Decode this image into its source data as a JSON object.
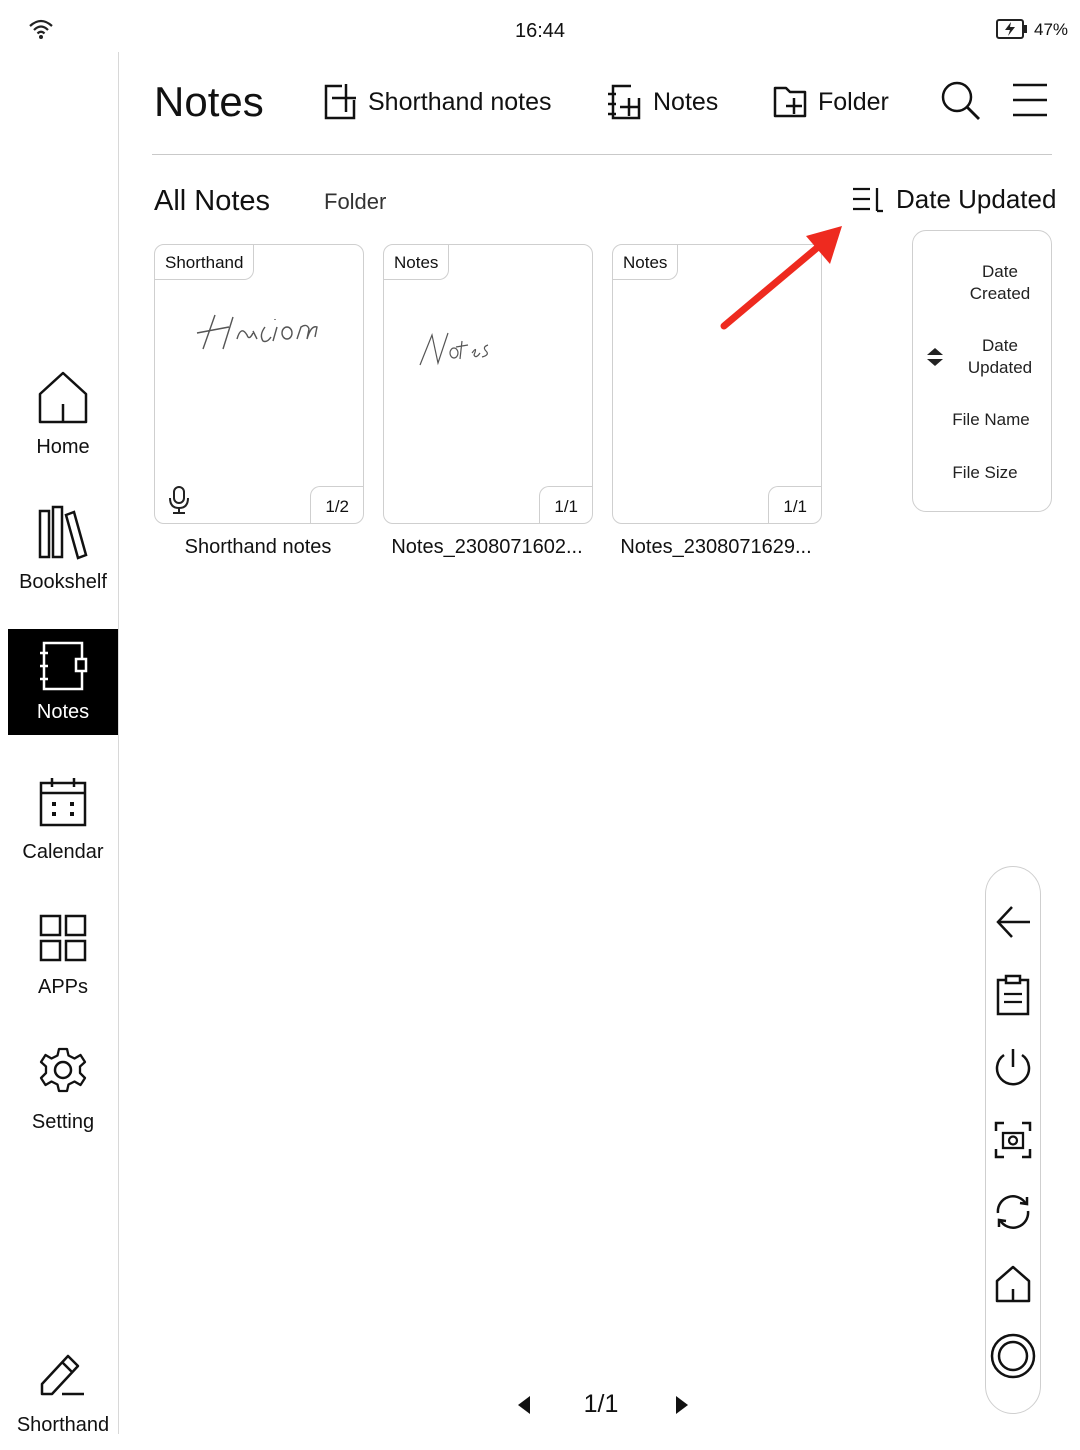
{
  "status_bar": {
    "time": "16:44",
    "battery": "47%"
  },
  "sidebar": {
    "items": [
      {
        "label": "Home",
        "icon": "home-icon"
      },
      {
        "label": "Bookshelf",
        "icon": "bookshelf-icon"
      },
      {
        "label": "Notes",
        "icon": "notebook-icon",
        "active": true
      },
      {
        "label": "Calendar",
        "icon": "calendar-icon"
      },
      {
        "label": "APPs",
        "icon": "apps-grid-icon"
      },
      {
        "label": "Setting",
        "icon": "gear-icon"
      },
      {
        "label": "Shorthand",
        "icon": "pen-icon"
      }
    ]
  },
  "header": {
    "title": "Notes",
    "actions": [
      {
        "label": "Shorthand notes",
        "icon": "new-shorthand-icon"
      },
      {
        "label": "Notes",
        "icon": "new-notebook-icon"
      },
      {
        "label": "Folder",
        "icon": "new-folder-icon"
      }
    ],
    "icons": [
      "search-icon",
      "menu-icon"
    ]
  },
  "tabs": {
    "all": "All Notes",
    "folder": "Folder"
  },
  "sort": {
    "label": "Date Updated",
    "options": [
      "Date Created",
      "Date Updated",
      "File Name",
      "File Size"
    ],
    "selected": "Date Updated"
  },
  "notes": [
    {
      "tag": "Shorthand",
      "pages": "1/2",
      "name": "Shorthand notes",
      "has_audio": true
    },
    {
      "tag": "Notes",
      "pages": "1/1",
      "name": "Notes_2308071602..."
    },
    {
      "tag": "Notes",
      "pages": "1/1",
      "name": "Notes_2308071629..."
    }
  ],
  "floating_toolbar": {
    "icons": [
      "back-arrow-icon",
      "clipboard-icon",
      "power-icon",
      "screenshot-icon",
      "refresh-icon",
      "home-icon",
      "circle-icon"
    ]
  },
  "pager": {
    "current": "1/1"
  },
  "annotation": {
    "arrow_color": "#ee2a1f"
  }
}
